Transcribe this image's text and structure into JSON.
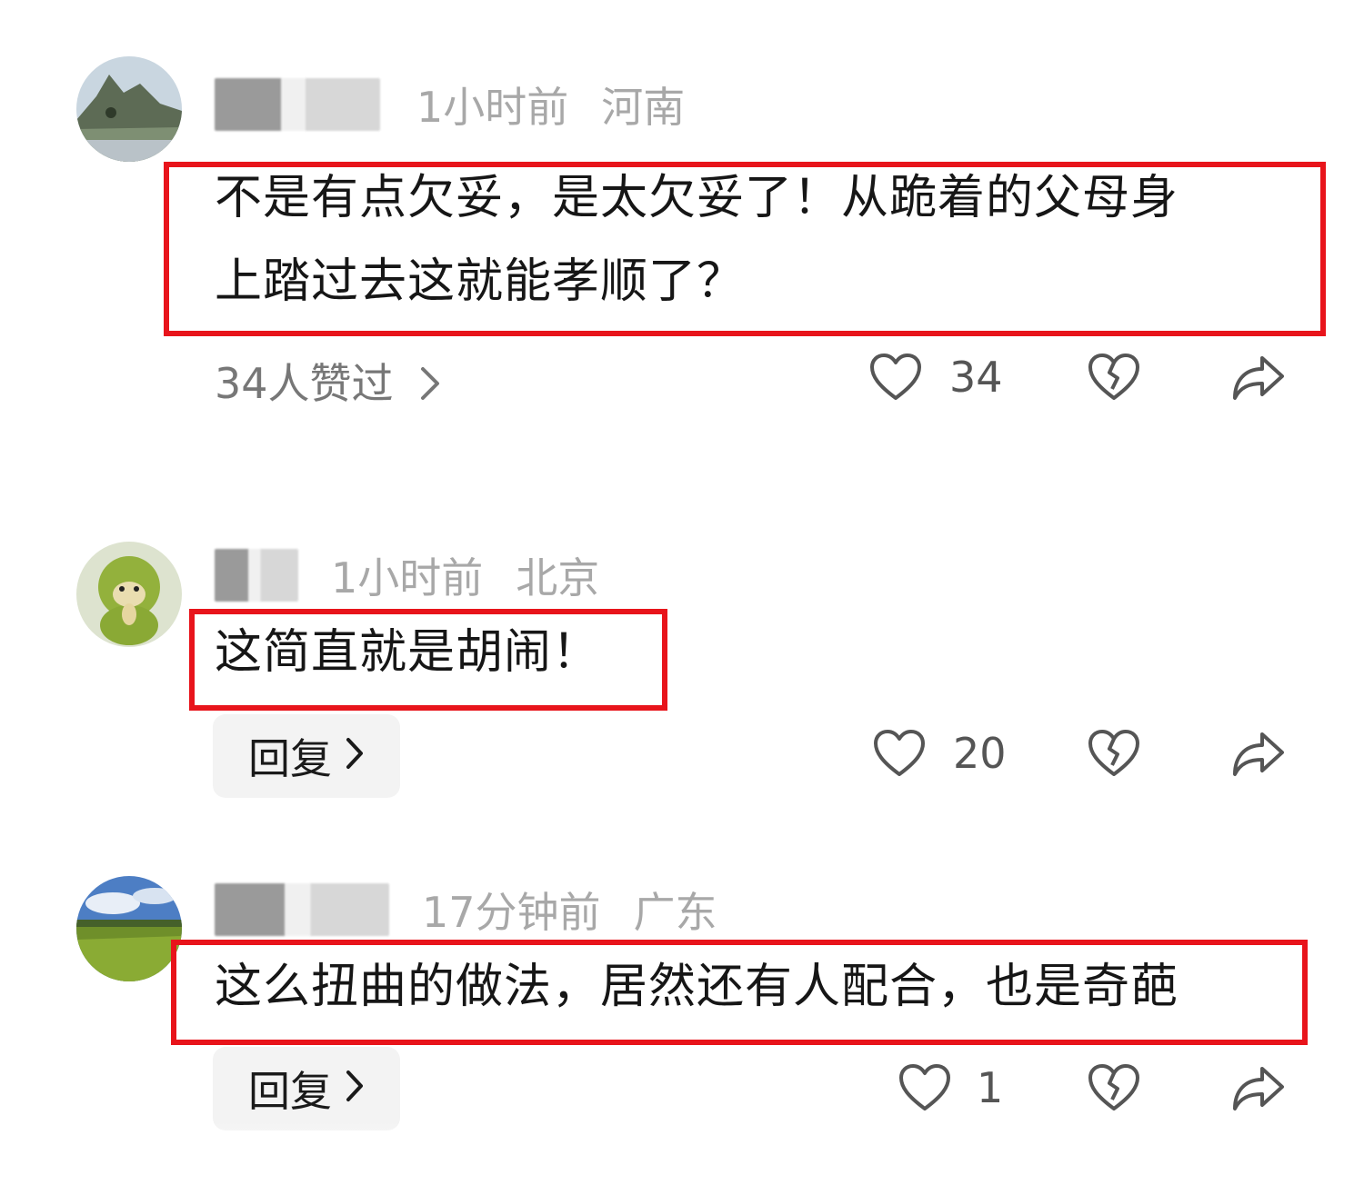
{
  "comments": [
    {
      "time": "1小时前",
      "location": "河南",
      "text_lines": [
        "不是有点欠妥，是太欠妥了！从跪着的父母身",
        "上踏过去这就能孝顺了？"
      ],
      "likers_label": "34人赞过",
      "like_count": "34",
      "highlight_color": "#e8141b"
    },
    {
      "time": "1小时前",
      "location": "北京",
      "text_lines": [
        "这简直就是胡闹！"
      ],
      "reply_label": "回复",
      "like_count": "20",
      "highlight_color": "#e8141b"
    },
    {
      "time": "17分钟前",
      "location": "广东",
      "text_lines": [
        "这么扭曲的做法，居然还有人配合，也是奇葩"
      ],
      "reply_label": "回复",
      "like_count": "1",
      "highlight_color": "#e8141b"
    }
  ],
  "icons": {
    "like": "heart-icon",
    "dislike": "broken-heart-icon",
    "share": "share-arrow-icon",
    "chevron": "chevron-right-icon"
  }
}
